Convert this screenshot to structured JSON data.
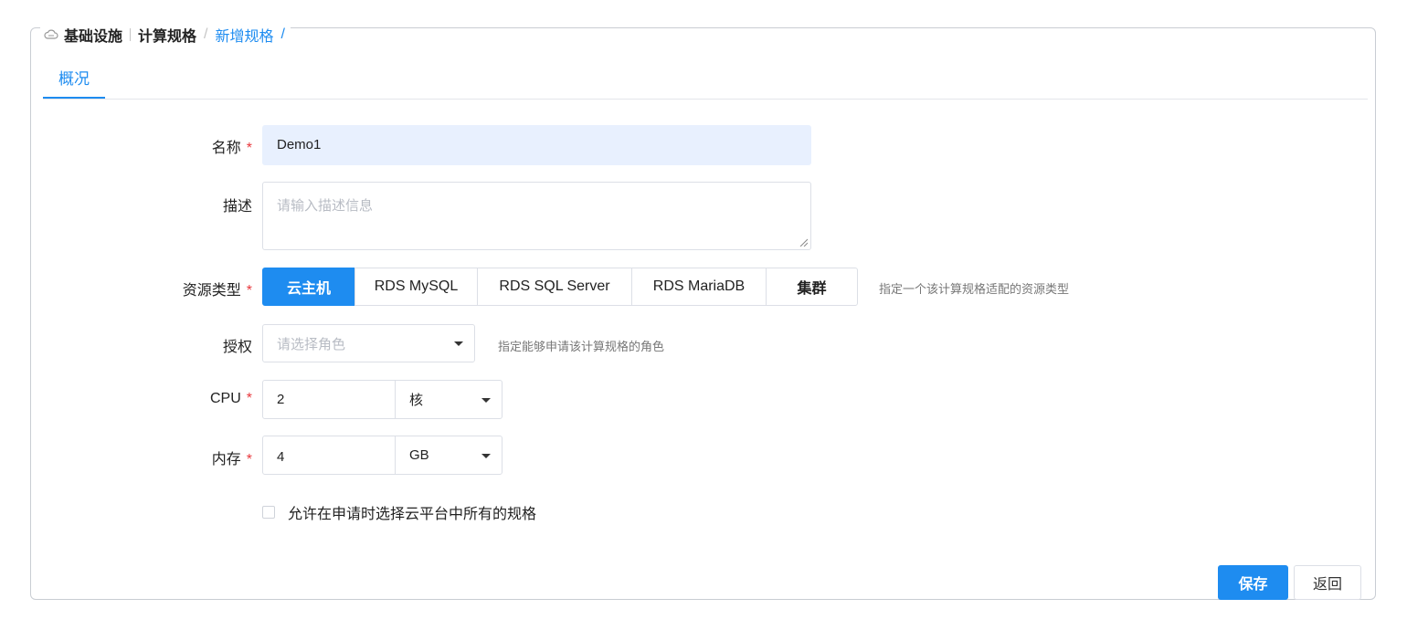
{
  "breadcrumb": {
    "icon": "cloud-icon",
    "section": "基础设施",
    "page": "计算规格",
    "current": "新增规格",
    "trailing_slash": "/"
  },
  "tabs": [
    {
      "label": "概况",
      "active": true
    }
  ],
  "form": {
    "name": {
      "label": "名称",
      "required_mark": "*",
      "value": "Demo1"
    },
    "description": {
      "label": "描述",
      "placeholder": "请输入描述信息",
      "value": ""
    },
    "resource_type": {
      "label": "资源类型",
      "required_mark": "*",
      "options": [
        "云主机",
        "RDS MySQL",
        "RDS SQL Server",
        "RDS MariaDB",
        "集群"
      ],
      "selected": "云主机",
      "hint": "指定一个该计算规格适配的资源类型"
    },
    "authorization": {
      "label": "授权",
      "placeholder": "请选择角色",
      "hint": "指定能够申请该计算规格的角色"
    },
    "cpu": {
      "label": "CPU",
      "required_mark": "*",
      "value": "2",
      "unit": "核"
    },
    "memory": {
      "label": "内存",
      "required_mark": "*",
      "value": "4",
      "unit": "GB"
    },
    "allow_all_specs": {
      "label": "允许在申请时选择云平台中所有的规格",
      "checked": false
    }
  },
  "actions": {
    "save_label": "保存",
    "back_label": "返回"
  },
  "colors": {
    "accent": "#1e8cf0",
    "required": "#e8383d",
    "filled_input_bg": "#e8f0fe"
  }
}
